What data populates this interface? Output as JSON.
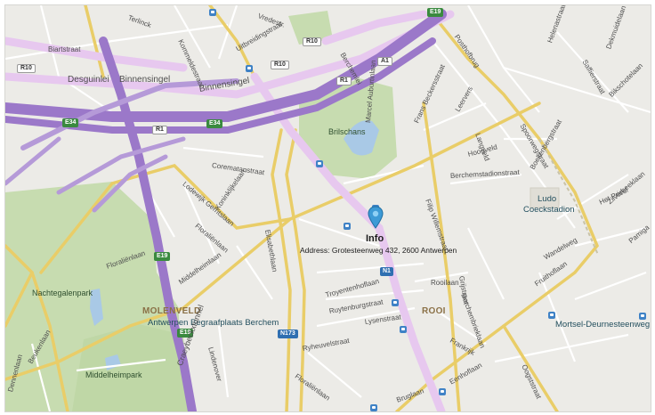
{
  "map": {
    "marker": {
      "title": "Info",
      "address": "Address: Grotesteenweg 432, 2600 Antwerpen"
    },
    "districts": [
      "MOLENVELD",
      "ROOI"
    ],
    "areas": [
      "Nachtegalenpark",
      "Middelheimpark",
      "Brilschans"
    ],
    "pois": [
      "Antwerpen Begraafplaats Berchem",
      "Mortsel-Deurnesteenweg",
      "Ludo",
      "Coeckstadion"
    ],
    "shields": [
      "E19",
      "R10",
      "R10",
      "R10",
      "A1",
      "R1",
      "R1",
      "E34",
      "E34",
      "E19",
      "E19",
      "N1",
      "N173"
    ],
    "streets": [
      "Biartstraat",
      "Terlinck",
      "Vredestr.",
      "Kommeldestraat",
      "Uitbreidingstraat",
      "Berchemlei",
      "Desguinlei",
      "Binnensingel",
      "Binnensingel",
      "Posthofbrug",
      "Helenastraat",
      "Dekmuidelaan",
      "Saffierstraat",
      "Bikschotelaan",
      "Marcel Auburtinlaan",
      "Frans Beckersstraat",
      "Leervers",
      "Langveld",
      "Spoorwegstraat",
      "Hoogveld",
      "Berchemstadionstraat",
      "Boekenbergstraat",
      "Filip Willemstraat",
      "Het Priesl",
      "Zilverbeeklaan",
      "Pamiga",
      "Corematanstraat",
      "Lodewijk Gerritslaan",
      "Floraliënlaan",
      "Koninklijkelaan",
      "Elisabethlaan",
      "Floraliënlaan",
      "Middelheimlaan",
      "Troyentenhoflaan",
      "Ruytenburgstraat",
      "Lysenstraat",
      "Rooilaan",
      "Ryheuvelstraat",
      "Floraliënlaan",
      "Lindenover",
      "Frankrijk",
      "Berchembrieklaan",
      "Wandelweg",
      "Fruithoflaan",
      "Grijstraat",
      "Oogststraat",
      "Bruglaan",
      "Eenhoflaan",
      "Craeybeckxtunnel",
      "Beukenlaan",
      "Dennenlaan"
    ]
  }
}
